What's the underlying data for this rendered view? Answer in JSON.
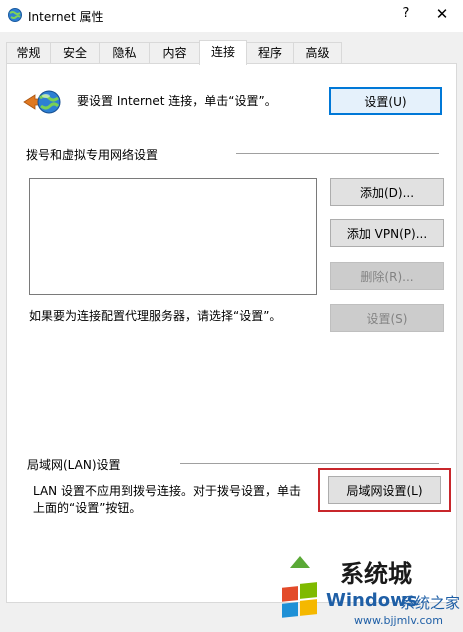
{
  "window": {
    "title": "Internet 属性",
    "help_glyph": "?",
    "close_glyph": "✕"
  },
  "tabs": [
    {
      "label": "常规"
    },
    {
      "label": "安全"
    },
    {
      "label": "隐私"
    },
    {
      "label": "内容"
    },
    {
      "label": "连接",
      "active": true
    },
    {
      "label": "程序"
    },
    {
      "label": "高级"
    }
  ],
  "setup": {
    "text": "要设置 Internet 连接，单击“设置”。",
    "button": "设置(U)"
  },
  "dialup": {
    "heading": "拨号和虚拟专用网络设置",
    "add_button": "添加(D)...",
    "add_vpn_button": "添加 VPN(P)...",
    "remove_button": "删除(R)...",
    "proxy_text": "如果要为连接配置代理服务器，请选择“设置”。",
    "settings_button": "设置(S)"
  },
  "lan": {
    "heading": "局域网(LAN)设置",
    "text_line1": "LAN 设置不应用到拨号连接。对于拨号设置，单击",
    "text_line2": "上面的“设置”按钮。",
    "button": "局域网设置(L)"
  },
  "watermark": {
    "brand_cn": "系统城",
    "windows": "Windows",
    "home_cn": "系统之家",
    "url": "www.bjjmlv.com"
  },
  "colors": {
    "highlight": "#c8262b",
    "focus_border": "#0078d7",
    "watermark_blue": "#1f5fa6"
  },
  "icons": {
    "title_icon": "internet-globe-icon",
    "setup_icon": "network-globe-arrow-icon",
    "watermark_logo": "windows-logo-icon"
  }
}
